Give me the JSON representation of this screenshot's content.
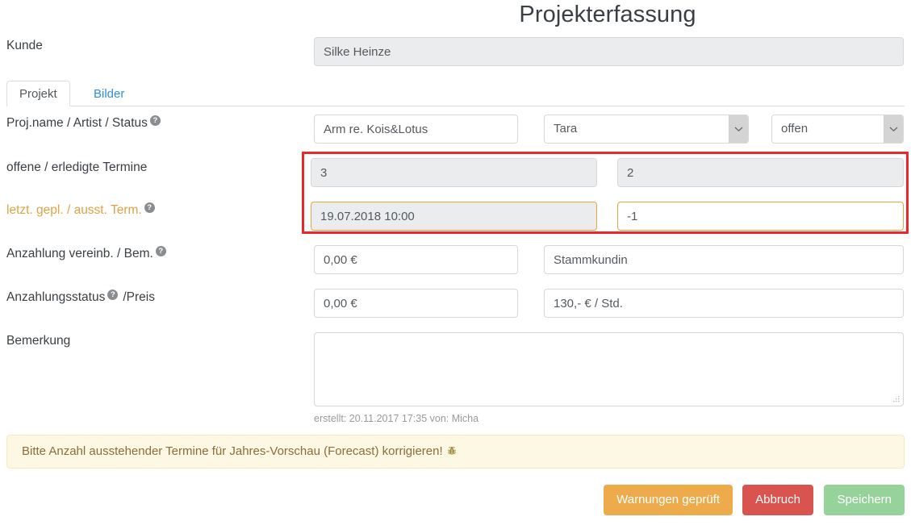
{
  "header": {
    "title": "Projekterfassung"
  },
  "customer": {
    "label": "Kunde",
    "value": "Silke Heinze"
  },
  "tabs": [
    {
      "label": "Projekt",
      "active": true
    },
    {
      "label": "Bilder",
      "active": false
    }
  ],
  "rows": {
    "project": {
      "label": "Proj.name / Artist / Status",
      "help": "?",
      "name_value": "Arm re. Kois&Lotus",
      "artist_value": "Tara",
      "status_value": "offen"
    },
    "appointments": {
      "label": "offene / erledigte Termine",
      "open_value": "3",
      "done_value": "2"
    },
    "last_planned": {
      "label": "letzt. gepl. / ausst. Term.",
      "help": "?",
      "date_value": "19.07.2018 10:00",
      "outstanding_value": "-1"
    },
    "deposit_agreed": {
      "label": "Anzahlung vereinb. / Bem.",
      "help": "?",
      "amount_value": "0,00 €",
      "note_value": "Stammkundin"
    },
    "deposit_status": {
      "label_part1": "Anzahlungsstatus",
      "help": "?",
      "label_part2": "/Preis",
      "amount_value": "0,00 €",
      "price_value": "130,- € / Std."
    },
    "remark": {
      "label": "Bemerkung",
      "value": "",
      "placeholder": ""
    }
  },
  "created": "erstellt: 20.11.2017 17:35 von: Micha",
  "warning": {
    "text": "Bitte Anzahl ausstehender Termine für Jahres-Vorschau (Forecast) korrigieren!",
    "icon": "bug-icon"
  },
  "buttons": {
    "warnings_checked": "Warnungen geprüft",
    "cancel": "Abbruch",
    "save": "Speichern"
  },
  "colors": {
    "warn_accent": "#e4a545",
    "highlight_red": "#e8282a",
    "banner_bg": "#fcf8e3",
    "banner_text": "#8a6d3b",
    "btn_warn": "#eeab4b",
    "btn_cancel": "#d9534f",
    "btn_save": "#96d39a",
    "link_blue": "#2f8ee0"
  }
}
